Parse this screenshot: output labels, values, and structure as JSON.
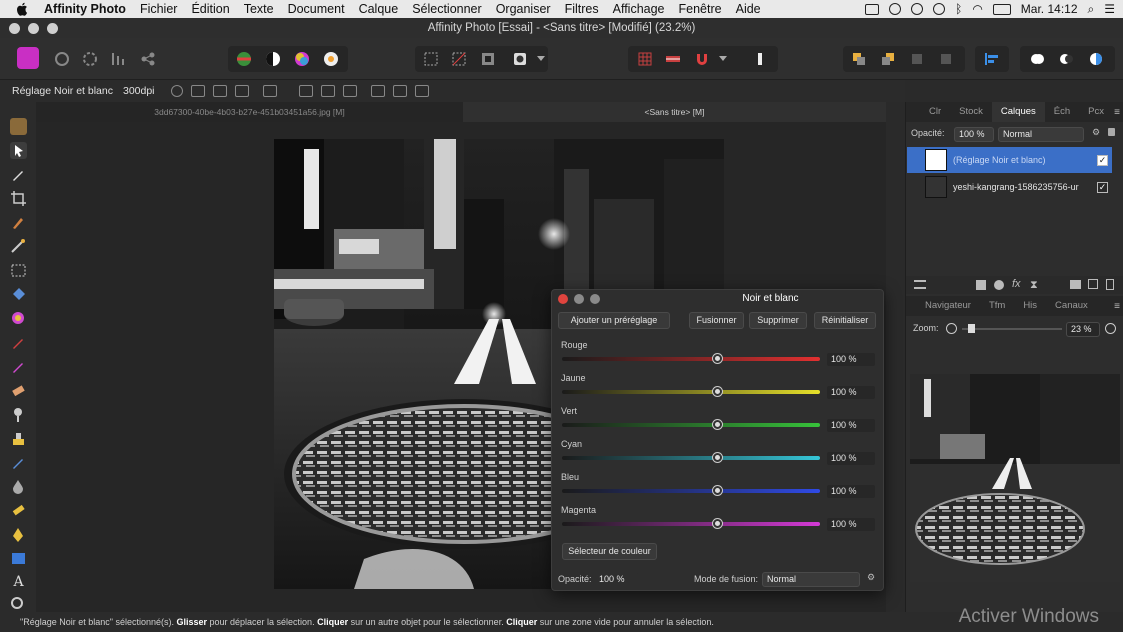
{
  "menubar": {
    "app_name": "Affinity Photo",
    "items": [
      "Fichier",
      "Édition",
      "Texte",
      "Document",
      "Calque",
      "Sélectionner",
      "Organiser",
      "Filtres",
      "Affichage",
      "Fenêtre",
      "Aide"
    ],
    "clock": "Mar. 14:12"
  },
  "window": {
    "title": "Affinity Photo [Essai] - <Sans titre> [Modifié] (23.2%)"
  },
  "context": {
    "tool_label": "Réglage Noir et blanc",
    "dpi": "300dpi"
  },
  "doc_tabs": [
    {
      "label": "3dd67300-40be-4b03-b27e-451b03451a56.jpg [M]"
    },
    {
      "label": "<Sans titre> [M]"
    }
  ],
  "layers_panel": {
    "tabs": [
      "Clr",
      "Stock",
      "Calques",
      "Éch",
      "Pcx"
    ],
    "active_tab": "Calques",
    "opacity_label": "Opacité:",
    "opacity_value": "100 %",
    "blend_mode": "Normal",
    "layers": [
      {
        "name": "(Réglage Noir et blanc)",
        "selected": true,
        "visible": true
      },
      {
        "name": "yeshi-kangrang-1586235756-ur",
        "selected": false,
        "visible": true
      }
    ]
  },
  "navigator_panel": {
    "tabs": [
      "Navigateur",
      "Tfm",
      "His",
      "Canaux"
    ],
    "zoom_label": "Zoom:",
    "zoom_value": "23 %"
  },
  "dialog": {
    "title": "Noir et blanc",
    "buttons": {
      "add_preset": "Ajouter un préréglage",
      "merge": "Fusionner",
      "delete": "Supprimer",
      "reset": "Réinitialiser",
      "color_picker": "Sélecteur de couleur"
    },
    "sliders": [
      {
        "label": "Rouge",
        "value": "100 %",
        "level": 0.6,
        "gradient": [
          "#1a1a1a",
          "#e23030"
        ]
      },
      {
        "label": "Jaune",
        "value": "100 %",
        "level": 0.6,
        "gradient": [
          "#1a1a1a",
          "#e6e02a"
        ]
      },
      {
        "label": "Vert",
        "value": "100 %",
        "level": 0.6,
        "gradient": [
          "#1a1a1a",
          "#37c23a"
        ]
      },
      {
        "label": "Cyan",
        "value": "100 %",
        "level": 0.6,
        "gradient": [
          "#1a1a1a",
          "#35c6d8"
        ]
      },
      {
        "label": "Bleu",
        "value": "100 %",
        "level": 0.6,
        "gradient": [
          "#1a1a1a",
          "#2f4ae6"
        ]
      },
      {
        "label": "Magenta",
        "value": "100 %",
        "level": 0.6,
        "gradient": [
          "#1a1a1a",
          "#d43ad6"
        ]
      }
    ],
    "footer": {
      "opacity_label": "Opacité:",
      "opacity_value": "100 %",
      "blend_label": "Mode de fusion:",
      "blend_value": "Normal"
    }
  },
  "status": {
    "part1": "\"Réglage Noir et blanc\" sélectionné(s). ",
    "b1": "Glisser",
    "part2": " pour déplacer la sélection. ",
    "b2": "Cliquer",
    "part3": " sur un autre objet pour le sélectionner. ",
    "b3": "Cliquer",
    "part4": " sur une zone vide pour annuler la sélection."
  },
  "watermark": "Activer Windows",
  "colors": {
    "accent": "#3b6fc7",
    "persona": "#c92fc4",
    "close": "#e0443e"
  }
}
